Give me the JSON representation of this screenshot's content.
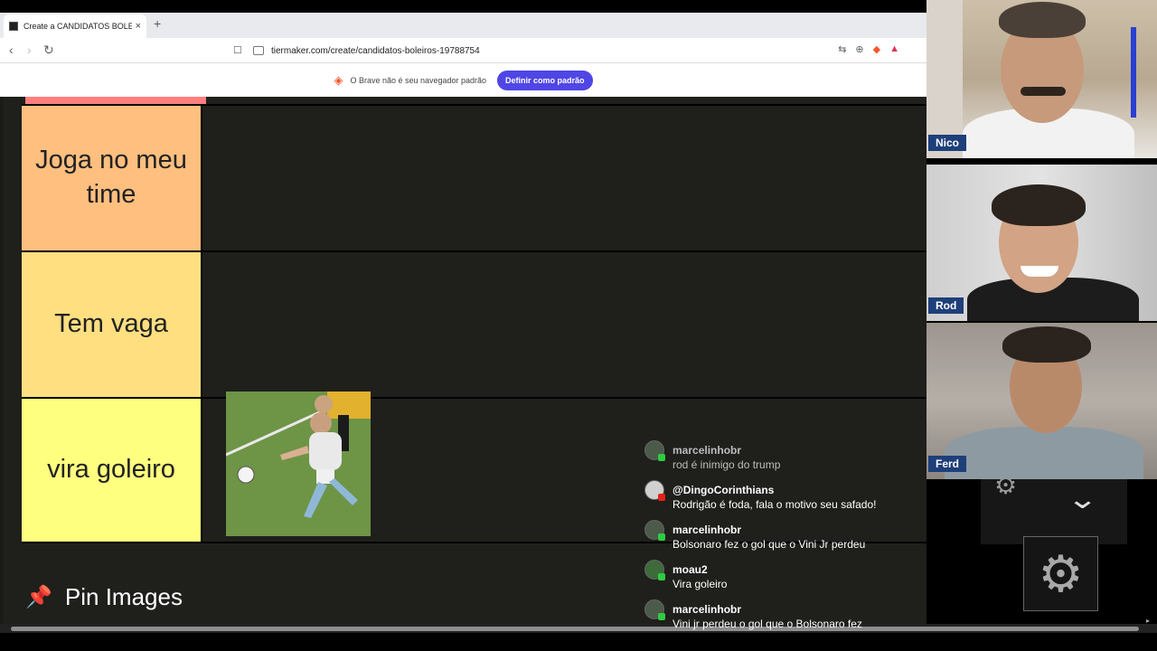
{
  "browser": {
    "tab_title": "Create a CANDIDATOS BOLEIROS",
    "tab_close": "×",
    "new_tab": "+",
    "back": "‹",
    "forward": "›",
    "reload": "↻",
    "bookmark": "☐",
    "url": "tiermaker.com/create/candidatos-boleiros-19788754"
  },
  "infobar": {
    "message": "O Brave não é seu navegador padrão",
    "button": "Definir como padrão"
  },
  "tiers": [
    {
      "label": "Joga no meu time",
      "color": "#ffbf7f"
    },
    {
      "label": "Tem vaga",
      "color": "#ffdf80"
    },
    {
      "label": "vira goleiro",
      "color": "#ffff7f"
    }
  ],
  "top_tier_color": "#ff7f7f",
  "pin_images": {
    "icon": "📌",
    "label": "Pin Images"
  },
  "cams": [
    {
      "name": "Nico"
    },
    {
      "name": "Rod"
    },
    {
      "name": "Ferd"
    }
  ],
  "chat": [
    {
      "user": "marcelinhobr",
      "text": "rod é inimigo do trump"
    },
    {
      "user": "@DingoCorinthians",
      "text": "Rodrigão é foda, fala o motivo seu safado!"
    },
    {
      "user": "marcelinhobr",
      "text": "Bolsonaro fez o gol que o Vini Jr perdeu"
    },
    {
      "user": "moau2",
      "text": "Vira goleiro"
    },
    {
      "user": "marcelinhobr",
      "text": "Vini jr perdeu o gol que o Bolsonaro fez"
    }
  ],
  "controls": {
    "chevron": "⌄",
    "gear": "⚙"
  }
}
